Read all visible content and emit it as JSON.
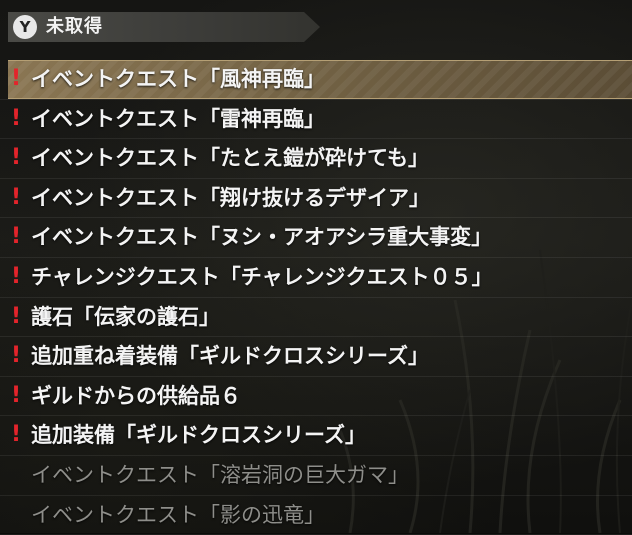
{
  "header": {
    "button_glyph": "Y",
    "title": "未取得"
  },
  "items": [
    {
      "label": "イベントクエスト「風神再臨」",
      "new": true,
      "selected": true,
      "done": false
    },
    {
      "label": "イベントクエスト「雷神再臨」",
      "new": true,
      "selected": false,
      "done": false
    },
    {
      "label": "イベントクエスト「たとえ鎧が砕けても」",
      "new": true,
      "selected": false,
      "done": false
    },
    {
      "label": "イベントクエスト「翔け抜けるデザイア」",
      "new": true,
      "selected": false,
      "done": false
    },
    {
      "label": "イベントクエスト「ヌシ・アオアシラ重大事変」",
      "new": true,
      "selected": false,
      "done": false
    },
    {
      "label": "チャレンジクエスト「チャレンジクエスト０５」",
      "new": true,
      "selected": false,
      "done": false
    },
    {
      "label": "護石「伝家の護石」",
      "new": true,
      "selected": false,
      "done": false
    },
    {
      "label": "追加重ね着装備「ギルドクロスシリーズ」",
      "new": true,
      "selected": false,
      "done": false
    },
    {
      "label": "ギルドからの供給品６",
      "new": true,
      "selected": false,
      "done": false
    },
    {
      "label": "追加装備「ギルドクロスシリーズ」",
      "new": true,
      "selected": false,
      "done": false
    },
    {
      "label": "イベントクエスト「溶岩洞の巨大ガマ」",
      "new": false,
      "selected": false,
      "done": true
    },
    {
      "label": "イベントクエスト「影の迅竜」",
      "new": false,
      "selected": false,
      "done": true
    }
  ],
  "new_marker": "!",
  "colors": {
    "new_marker": "#e3242b",
    "selected_row": "#7a6849",
    "text": "#f4f4f4",
    "text_done": "#8e8e8a"
  }
}
